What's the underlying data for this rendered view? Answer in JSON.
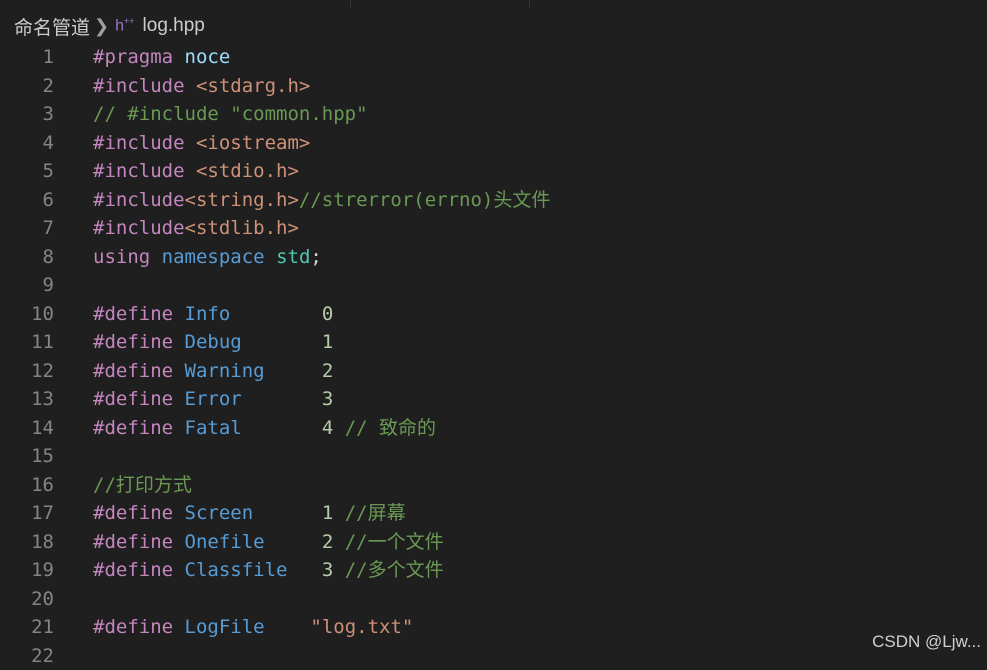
{
  "breadcrumb": {
    "folder": "命名管道",
    "separator": ">",
    "file_icon": "h",
    "file_icon_suffix": "++",
    "file_name": "log.hpp"
  },
  "editor": {
    "colors": {
      "background": "#1f1f1f",
      "directive": "#c586c0",
      "string": "#ce9178",
      "comment": "#6a9955",
      "macro": "#569cd6",
      "number": "#b5cea8",
      "line_number": "#858585"
    },
    "lines": [
      {
        "num": "1",
        "tokens": [
          {
            "t": "#pragma",
            "c": "dir"
          },
          {
            "t": " "
          },
          {
            "t": "noce",
            "c": "noce"
          }
        ]
      },
      {
        "num": "2",
        "tokens": [
          {
            "t": "#include",
            "c": "dir"
          },
          {
            "t": " "
          },
          {
            "t": "<stdarg.h>",
            "c": "str"
          }
        ]
      },
      {
        "num": "3",
        "tokens": [
          {
            "t": "// #include \"common.hpp\"",
            "c": "com"
          }
        ]
      },
      {
        "num": "4",
        "tokens": [
          {
            "t": "#include",
            "c": "dir"
          },
          {
            "t": " "
          },
          {
            "t": "<iostream>",
            "c": "str"
          }
        ]
      },
      {
        "num": "5",
        "tokens": [
          {
            "t": "#include",
            "c": "dir"
          },
          {
            "t": " "
          },
          {
            "t": "<stdio.h>",
            "c": "str"
          }
        ]
      },
      {
        "num": "6",
        "tokens": [
          {
            "t": "#include",
            "c": "dir"
          },
          {
            "t": "<string.h>",
            "c": "str"
          },
          {
            "t": "//strerror(errno)头文件",
            "c": "com"
          }
        ]
      },
      {
        "num": "7",
        "tokens": [
          {
            "t": "#include",
            "c": "dir"
          },
          {
            "t": "<stdlib.h>",
            "c": "str"
          }
        ]
      },
      {
        "num": "8",
        "tokens": [
          {
            "t": "using",
            "c": "kw"
          },
          {
            "t": " "
          },
          {
            "t": "namespace",
            "c": "ns"
          },
          {
            "t": " "
          },
          {
            "t": "std",
            "c": "id"
          },
          {
            "t": ";",
            "c": "punc"
          }
        ]
      },
      {
        "num": "9",
        "tokens": []
      },
      {
        "num": "10",
        "tokens": [
          {
            "t": "#define",
            "c": "dir"
          },
          {
            "t": " "
          },
          {
            "t": "Info",
            "c": "mac"
          },
          {
            "t": "        "
          },
          {
            "t": "0",
            "c": "num"
          }
        ]
      },
      {
        "num": "11",
        "tokens": [
          {
            "t": "#define",
            "c": "dir"
          },
          {
            "t": " "
          },
          {
            "t": "Debug",
            "c": "mac"
          },
          {
            "t": "       "
          },
          {
            "t": "1",
            "c": "num"
          }
        ]
      },
      {
        "num": "12",
        "tokens": [
          {
            "t": "#define",
            "c": "dir"
          },
          {
            "t": " "
          },
          {
            "t": "Warning",
            "c": "mac"
          },
          {
            "t": "     "
          },
          {
            "t": "2",
            "c": "num"
          }
        ]
      },
      {
        "num": "13",
        "tokens": [
          {
            "t": "#define",
            "c": "dir"
          },
          {
            "t": " "
          },
          {
            "t": "Error",
            "c": "mac"
          },
          {
            "t": "       "
          },
          {
            "t": "3",
            "c": "num"
          }
        ]
      },
      {
        "num": "14",
        "tokens": [
          {
            "t": "#define",
            "c": "dir"
          },
          {
            "t": " "
          },
          {
            "t": "Fatal",
            "c": "mac"
          },
          {
            "t": "       "
          },
          {
            "t": "4",
            "c": "num"
          },
          {
            "t": " "
          },
          {
            "t": "// 致命的",
            "c": "com"
          }
        ]
      },
      {
        "num": "15",
        "tokens": []
      },
      {
        "num": "16",
        "tokens": [
          {
            "t": "//打印方式",
            "c": "com"
          }
        ]
      },
      {
        "num": "17",
        "tokens": [
          {
            "t": "#define",
            "c": "dir"
          },
          {
            "t": " "
          },
          {
            "t": "Screen",
            "c": "mac"
          },
          {
            "t": "      "
          },
          {
            "t": "1",
            "c": "num"
          },
          {
            "t": " "
          },
          {
            "t": "//屏幕",
            "c": "com"
          }
        ]
      },
      {
        "num": "18",
        "tokens": [
          {
            "t": "#define",
            "c": "dir"
          },
          {
            "t": " "
          },
          {
            "t": "Onefile",
            "c": "mac"
          },
          {
            "t": "     "
          },
          {
            "t": "2",
            "c": "num"
          },
          {
            "t": " "
          },
          {
            "t": "//一个文件",
            "c": "com"
          }
        ]
      },
      {
        "num": "19",
        "tokens": [
          {
            "t": "#define",
            "c": "dir"
          },
          {
            "t": " "
          },
          {
            "t": "Classfile",
            "c": "mac"
          },
          {
            "t": "   "
          },
          {
            "t": "3",
            "c": "num"
          },
          {
            "t": " "
          },
          {
            "t": "//多个文件",
            "c": "com"
          }
        ]
      },
      {
        "num": "20",
        "tokens": []
      },
      {
        "num": "21",
        "tokens": [
          {
            "t": "#define",
            "c": "dir"
          },
          {
            "t": " "
          },
          {
            "t": "LogFile",
            "c": "mac"
          },
          {
            "t": "    "
          },
          {
            "t": "\"log.txt\"",
            "c": "str"
          }
        ]
      },
      {
        "num": "22",
        "tokens": []
      }
    ]
  },
  "watermark": "CSDN @Ljw..."
}
